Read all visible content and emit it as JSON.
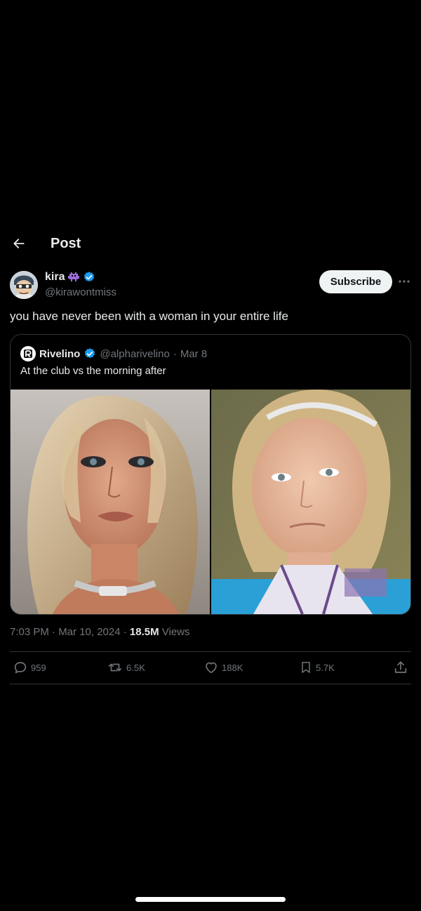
{
  "header": {
    "title": "Post"
  },
  "author": {
    "name": "kira",
    "handle": "@kirawontmiss",
    "subscribe_label": "Subscribe"
  },
  "post": {
    "text": "you have never been with a woman in your entire life"
  },
  "quote": {
    "name": "Rivelino",
    "handle": "@alpharivelino",
    "separator": "·",
    "date": "Mar 8",
    "text": "At the club vs the morning after"
  },
  "meta": {
    "time": "7:03 PM · Mar 10, 2024 · ",
    "views_count": "18.5M",
    "views_label": " Views"
  },
  "actions": {
    "replies": "959",
    "reposts": "6.5K",
    "likes": "188K",
    "bookmarks": "5.7K"
  },
  "icons": {
    "back": "arrow-left-icon",
    "verified": "verified-badge-icon",
    "badge": "alien-badge-icon",
    "more": "more-horizontal-icon",
    "reply": "reply-icon",
    "repost": "repost-icon",
    "like": "heart-icon",
    "bookmark": "bookmark-icon",
    "share": "share-icon"
  },
  "colors": {
    "background": "#000000",
    "verified": "#1d9bf0",
    "muted": "#71767b"
  }
}
